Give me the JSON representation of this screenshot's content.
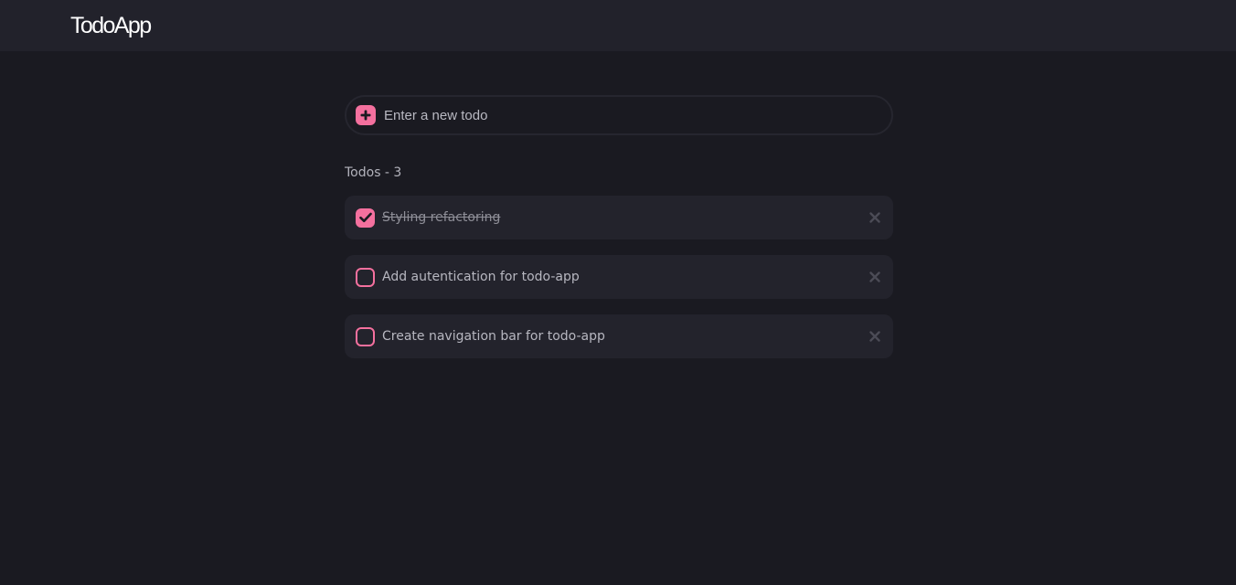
{
  "header": {
    "logo": "TodoApp"
  },
  "new_todo": {
    "placeholder": "Enter a new todo",
    "icon": "plus-icon"
  },
  "todos_count_label": "Todos - 3",
  "todos": [
    {
      "text": "Styling refactoring",
      "completed": true
    },
    {
      "text": "Add autentication for todo-app",
      "completed": false
    },
    {
      "text": "Create navigation bar for todo-app",
      "completed": false
    }
  ],
  "colors": {
    "accent": "#f4709e",
    "background": "#1a1a21",
    "header": "#22222b",
    "card": "#23232c"
  }
}
